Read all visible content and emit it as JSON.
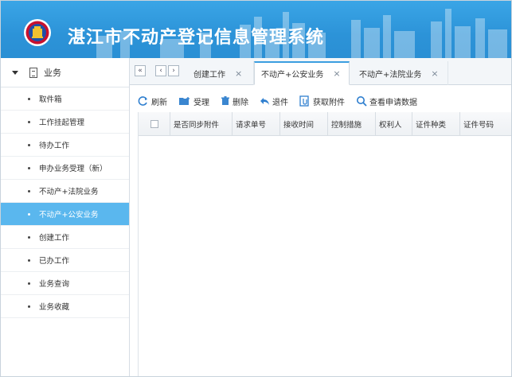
{
  "header": {
    "title": "湛江市不动产登记信息管理系统",
    "logo_icon": "government-emblem-icon",
    "bg_color": "#2c93d8"
  },
  "sidebar": {
    "section_label": "业务",
    "section_icon": "document-icon",
    "items": [
      {
        "label": "取件箱",
        "active": false
      },
      {
        "label": "工作挂起管理",
        "active": false
      },
      {
        "label": "待办工作",
        "active": false
      },
      {
        "label": "申办业务受理（新）",
        "active": false
      },
      {
        "label": "不动产+法院业务",
        "active": false
      },
      {
        "label": "不动产+公安业务",
        "active": true
      },
      {
        "label": "创建工作",
        "active": false
      },
      {
        "label": "已办工作",
        "active": false
      },
      {
        "label": "业务查询",
        "active": false
      },
      {
        "label": "业务收藏",
        "active": false
      }
    ],
    "active_color": "#5ab7ee"
  },
  "tabs": {
    "nav_first": "«",
    "nav_prev": "‹",
    "nav_next": "›",
    "close_glyph": "×",
    "items": [
      {
        "label": "创建工作",
        "active": false
      },
      {
        "label": "不动产+公安业务",
        "active": true
      },
      {
        "label": "不动产+法院业务",
        "active": false
      }
    ]
  },
  "toolbar": {
    "refresh": "刷新",
    "accept": "受理",
    "delete": "删除",
    "return": "退件",
    "get_attachment": "获取附件",
    "view_application": "查看申请数据"
  },
  "grid": {
    "columns": [
      "是否同步附件",
      "请求单号",
      "接收时间",
      "控制措施",
      "权利人",
      "证件种类",
      "证件号码"
    ],
    "rows": []
  }
}
